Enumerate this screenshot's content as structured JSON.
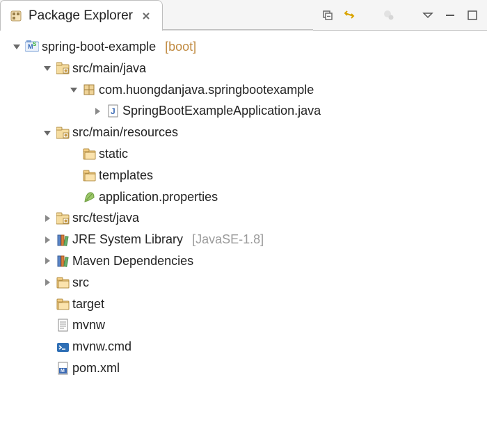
{
  "tab": {
    "title": "Package Explorer"
  },
  "project": {
    "name": "spring-boot-example",
    "suffix": "[boot]",
    "srcMainJava": {
      "label": "src/main/java"
    },
    "package": {
      "label": "com.huongdanjava.springbootexample"
    },
    "appFile": {
      "label": "SpringBootExampleApplication.java"
    },
    "srcMainResources": {
      "label": "src/main/resources"
    },
    "staticFolder": {
      "label": "static"
    },
    "templates": {
      "label": "templates"
    },
    "appProps": {
      "label": "application.properties"
    },
    "srcTestJava": {
      "label": "src/test/java"
    },
    "jre": {
      "label": "JRE System Library",
      "suffix": "[JavaSE-1.8]"
    },
    "maven": {
      "label": "Maven Dependencies"
    },
    "src": {
      "label": "src"
    },
    "target": {
      "label": "target"
    },
    "mvnw": {
      "label": "mvnw"
    },
    "mvnwCmd": {
      "label": "mvnw.cmd"
    },
    "pom": {
      "label": "pom.xml"
    }
  }
}
